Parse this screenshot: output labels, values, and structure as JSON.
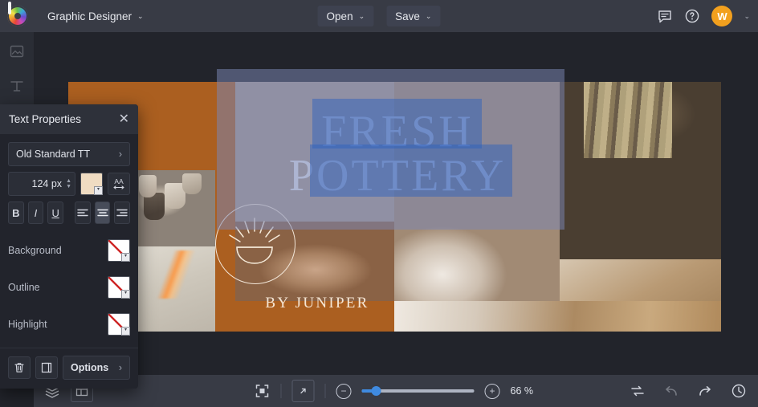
{
  "topbar": {
    "logo": "boxy-logo-icon",
    "document_title": "Graphic Designer",
    "open_label": "Open",
    "save_label": "Save",
    "comments_icon": "comment-icon",
    "help_icon": "help-icon",
    "avatar_initial": "W",
    "caret": "⌄"
  },
  "panel": {
    "title": "Text Properties",
    "close": "✕",
    "font_family": "Old Standard TT",
    "font_size": "124 px",
    "text_color_hex": "#f0dcc2",
    "letter_spacing_icon": "AA",
    "bold": "B",
    "italic": "I",
    "underline": "U",
    "align_left": "align-left",
    "align_center": "align-center",
    "align_right": "align-right",
    "active_alignment": "align-center",
    "colors": [
      {
        "label": "Background",
        "value": "none"
      },
      {
        "label": "Outline",
        "value": "none"
      },
      {
        "label": "Highlight",
        "value": "none"
      }
    ],
    "delete_icon": "trash-icon",
    "duplicate_icon": "duplicate-icon",
    "options_label": "Options",
    "options_caret": "›",
    "field_caret": "›"
  },
  "canvas": {
    "headline": "FRESH\nPOTTERY",
    "byline": "BY JUNIPER",
    "background_hex": "#ab5f20",
    "headline_color_hex": "#e3e8f2",
    "selection_color_hex": "#2c60be",
    "object_selection_hex": "#7a86b4",
    "badge_icon": "bowl-rays-icon"
  },
  "bottombar": {
    "layers_icon": "layers-icon",
    "pages_icon": "pages-icon",
    "fit_icon": "fit-to-screen-icon",
    "fullscreen_icon": "expand-icon",
    "zoom_out": "−",
    "zoom_in": "+",
    "zoom_level": "66 %",
    "zoom_slider_percent": 13,
    "swap_icon": "swap-icon",
    "undo_icon": "undo-icon",
    "redo_icon": "redo-icon",
    "history_icon": "history-clock-icon"
  }
}
